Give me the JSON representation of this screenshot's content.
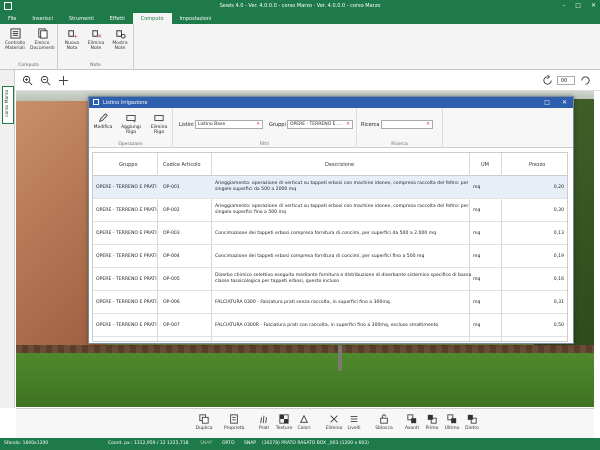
{
  "app": {
    "title": "Sewis 4.0 - Ver. 4.0.0.0 - corso Marzo · Ver. 4.0.0.0 - corso Marzo"
  },
  "menu_tabs": [
    "File",
    "Inserisci",
    "Strumenti",
    "Effetti",
    "Computo",
    "Impostazioni"
  ],
  "ribbon": {
    "groups": [
      {
        "label": "Computo",
        "buttons": [
          {
            "label": "Controllo Materiali",
            "icon": "checklist-icon"
          },
          {
            "label": "Elenco Documenti",
            "icon": "documents-icon"
          }
        ]
      },
      {
        "label": "Note",
        "buttons": [
          {
            "label": "Nuova Nota",
            "icon": "new-note-icon"
          },
          {
            "label": "Elimina Note",
            "icon": "delete-note-icon"
          },
          {
            "label": "Mostra Note",
            "icon": "show-note-icon"
          }
        ]
      }
    ]
  },
  "view_strip": {
    "zoom_value": "00"
  },
  "side_tab_label": "corso Marzo",
  "dialog": {
    "title": "Listino Irrigazione",
    "groups": {
      "operations": {
        "label": "Operazioni",
        "buttons": [
          "Modifica",
          "Aggiungi Riga",
          "Elimina Riga"
        ]
      },
      "filters": {
        "label": "Filtri",
        "listino_label": "Listini",
        "listino_value": "Listino Base",
        "gruppi_label": "Gruppi",
        "gruppi_value": "OPERE - TERRENO E ..."
      },
      "search": {
        "label": "Ricerca",
        "field_label": "Ricerca",
        "value": ""
      }
    },
    "table": {
      "columns": [
        "Gruppo",
        "Codice Articolo",
        "Descrizione",
        "UM",
        "Prezzo"
      ],
      "rows": [
        {
          "gruppo": "OPERE - TERRENO E PRATI",
          "codice": "OP-001",
          "desc1": "Arieggiamento: operazione di verticut su tappeti erbosi con machine idonee, compresa raccolta del feltro: per",
          "desc2": "singole superfici da 500 a 2000 mq",
          "um": "mq",
          "prezzo": "0,20"
        },
        {
          "gruppo": "OPERE - TERRENO E PRATI",
          "codice": "OP-002",
          "desc1": "Arieggiamento: operazione di verticut su tappeti erbosi con machine idonee, compresa raccolta del feltro: per",
          "desc2": "singole superfici fino a 500 mq",
          "um": "mq",
          "prezzo": "0,30"
        },
        {
          "gruppo": "OPERE - TERRENO E PRATI",
          "codice": "OP-003",
          "desc1": "Concimazione dei tappeti erbosi compresa fornitura di concimi, per superfici da 500 a 2.000 mq",
          "desc2": "",
          "um": "mq",
          "prezzo": "0,13"
        },
        {
          "gruppo": "OPERE - TERRENO E PRATI",
          "codice": "OP-004",
          "desc1": "Concimazione dei tappeti erbosi compresa fornitura di concimi, per superfici fino a 500 mq",
          "desc2": "",
          "um": "mq",
          "prezzo": "0,19"
        },
        {
          "gruppo": "OPERE - TERRENO E PRATI",
          "codice": "OP-005",
          "desc1": "Diserbo chimico selettivo eseguito mediante fornitura e distribuzione di diserbante sistemico specifico di bassa",
          "desc2": "classe tossicologica per tappeti erbosi, questo incluso",
          "um": "mq",
          "prezzo": "0,16"
        },
        {
          "gruppo": "OPERE - TERRENO E PRATI",
          "codice": "OP-006",
          "desc1": "FALCIATURA 0300 - Falciatura prati senza raccolta, in superfici fino a 300mq.",
          "desc2": "",
          "um": "mq",
          "prezzo": "0,31"
        },
        {
          "gruppo": "OPERE - TERRENO E PRATI",
          "codice": "OP-007",
          "desc1": "FALCIATURA 0300R - Falciatura prati con raccolta, in superfici fino a 300mq, escluso smaltimento",
          "desc2": "",
          "um": "mq",
          "prezzo": "0,50"
        }
      ]
    }
  },
  "bottom_toolbar": [
    "Duplica",
    "Proprietà",
    "Prati",
    "Texture",
    "Colori",
    "Elimina",
    "Livelli",
    "Sblocca",
    "Avanti",
    "Primo",
    "Ultimo",
    "Dietro"
  ],
  "status_bar": {
    "zoom": "Sfondo: 1600x1200",
    "coords": "Coord. px.: 1312,959 / 12 1225,718",
    "toggles": [
      "SNAP",
      "ORTO",
      "SNAP"
    ],
    "info": "(30278) PRATO RASATO BOX _003 (1200 x 603)"
  },
  "colors": {
    "accent": "#1f7a4a",
    "dialog_title": "#2e5fae",
    "selection": "#e7eef8"
  }
}
